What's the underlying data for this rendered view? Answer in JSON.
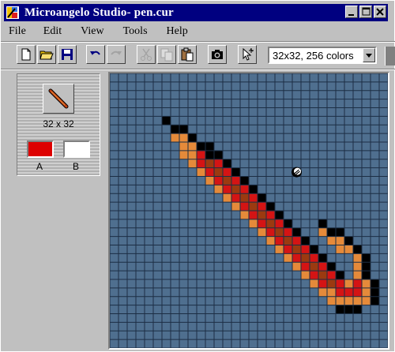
{
  "window": {
    "title": "Microangelo Studio- pen.cur",
    "minimize": "minimize",
    "maximize": "maximize",
    "close": "close"
  },
  "menu": {
    "items": [
      "File",
      "Edit",
      "View",
      "Tools",
      "Help"
    ]
  },
  "toolbar": {
    "tools": [
      {
        "name": "new",
        "icon": "new-file-icon",
        "enabled": true
      },
      {
        "name": "open",
        "icon": "open-folder-icon",
        "enabled": true
      },
      {
        "name": "save",
        "icon": "save-disk-icon",
        "enabled": true
      },
      {
        "name": "undo",
        "icon": "undo-icon",
        "enabled": true
      },
      {
        "name": "redo",
        "icon": "redo-icon",
        "enabled": false
      },
      {
        "name": "cut",
        "icon": "cut-icon",
        "enabled": false
      },
      {
        "name": "copy",
        "icon": "copy-icon",
        "enabled": false
      },
      {
        "name": "paste",
        "icon": "paste-icon",
        "enabled": true
      },
      {
        "name": "snapshot",
        "icon": "camera-icon",
        "enabled": true
      },
      {
        "name": "hotspot",
        "icon": "hotspot-cursor-icon",
        "enabled": true
      }
    ],
    "format_value": "32x32, 256 colors"
  },
  "side_panel": {
    "preview_size": "32 x 32",
    "color_a_label": "A",
    "color_b_label": "B",
    "color_a": "#dd0000",
    "color_b": "#ffffff"
  },
  "editor": {
    "grid_size": 32,
    "background": "#4f6f8f",
    "grid_color": "#1c2e44",
    "palette": {
      "k": "#000000",
      "o": "#e58a3a",
      "r": "#d41414",
      "d": "#9b3a10"
    },
    "pixels": [
      {
        "row": 5,
        "start": 6,
        "codes": "k"
      },
      {
        "row": 6,
        "start": 7,
        "codes": "kk"
      },
      {
        "row": 7,
        "start": 7,
        "codes": "ook"
      },
      {
        "row": 8,
        "start": 8,
        "codes": "ookk"
      },
      {
        "row": 9,
        "start": 8,
        "codes": "oorkk"
      },
      {
        "row": 10,
        "start": 9,
        "codes": "ordrk"
      },
      {
        "row": 11,
        "start": 10,
        "codes": "ordrk"
      },
      {
        "row": 12,
        "start": 11,
        "codes": "ordrk"
      },
      {
        "row": 13,
        "start": 12,
        "codes": "ordrk"
      },
      {
        "row": 14,
        "start": 13,
        "codes": "ordrk"
      },
      {
        "row": 15,
        "start": 14,
        "codes": "ordrk"
      },
      {
        "row": 16,
        "start": 15,
        "codes": "ordrk"
      },
      {
        "row": 17,
        "start": 16,
        "codes": "ordrk"
      },
      {
        "row": 17,
        "start": 24,
        "codes": "k"
      },
      {
        "row": 18,
        "start": 17,
        "codes": "ordrk"
      },
      {
        "row": 18,
        "start": 24,
        "codes": "okk"
      },
      {
        "row": 19,
        "start": 18,
        "codes": "ordrk"
      },
      {
        "row": 19,
        "start": 25,
        "codes": "ook"
      },
      {
        "row": 20,
        "start": 19,
        "codes": "ordrk"
      },
      {
        "row": 20,
        "start": 26,
        "codes": "ook"
      },
      {
        "row": 21,
        "start": 20,
        "codes": "ordrk"
      },
      {
        "row": 21,
        "start": 28,
        "codes": "ok"
      },
      {
        "row": 22,
        "start": 21,
        "codes": "ordrk"
      },
      {
        "row": 22,
        "start": 28,
        "codes": "ok"
      },
      {
        "row": 23,
        "start": 22,
        "codes": "ordrk"
      },
      {
        "row": 23,
        "start": 28,
        "codes": "ok"
      },
      {
        "row": 24,
        "start": 23,
        "codes": "ordrorok"
      },
      {
        "row": 25,
        "start": 24,
        "codes": "oorrrok"
      },
      {
        "row": 26,
        "start": 25,
        "codes": "oooook"
      },
      {
        "row": 27,
        "start": 26,
        "codes": "kkk"
      }
    ],
    "cursor_cell": {
      "row": 11,
      "col": 21
    },
    "cursor_icon": "hotspot-cursor-icon"
  }
}
